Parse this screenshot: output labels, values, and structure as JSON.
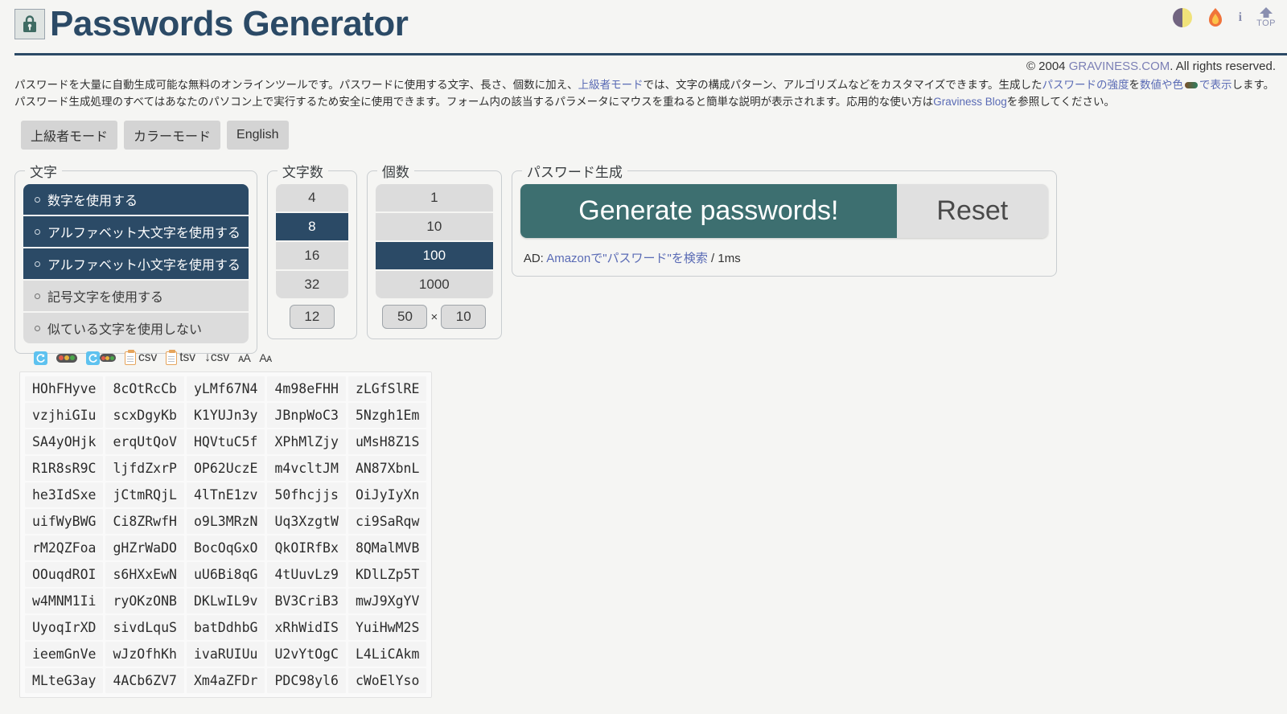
{
  "header": {
    "title": "Passwords Generator",
    "lock_icon": "lock-icon",
    "icons": [
      {
        "name": "theme-toggle-icon",
        "label": ""
      },
      {
        "name": "flame-icon",
        "label": ""
      },
      {
        "name": "info-icon",
        "label": "i"
      },
      {
        "name": "back-to-top-icon",
        "label": "TOP"
      }
    ]
  },
  "copyright": {
    "prefix": "© 2004 ",
    "link": "GRAVINESS.COM",
    "suffix": ". All rights reserved."
  },
  "description": {
    "p1_a": "パスワードを大量に自動生成可能な無料のオンラインツールです。パスワードに使用する文字、長さ、個数に加え、",
    "link1": "上級者モード",
    "p1_b": "では、文字の構成パターン、アルゴリズムなどをカスタマイズできます。生成した",
    "link2": "パスワードの強度",
    "p1_c": "を",
    "link3": "数値や色",
    "p1_d": "で表示",
    "p1_e": "します。パスワード生成処理のすべてはあなたのパソコン上で実行するため安全に使用できます。フォーム内の該当するパラメータにマウスを重ねると簡単な説明が表示されます。応用的な使い方は",
    "link4": "Graviness Blog",
    "p1_f": "を参照してください。"
  },
  "modes": [
    {
      "label": "上級者モード",
      "name": "advanced-mode-button"
    },
    {
      "label": "カラーモード",
      "name": "color-mode-button"
    },
    {
      "label": "English",
      "name": "english-mode-button"
    }
  ],
  "panels": {
    "chars": {
      "legend": "文字",
      "options": [
        {
          "label": "数字を使用する",
          "selected": true
        },
        {
          "label": "アルファベット大文字を使用する",
          "selected": true
        },
        {
          "label": "アルファベット小文字を使用する",
          "selected": true
        },
        {
          "label": "記号文字を使用する",
          "selected": false
        },
        {
          "label": "似ている文字を使用しない",
          "selected": false
        }
      ]
    },
    "length": {
      "legend": "文字数",
      "options": [
        {
          "label": "4",
          "selected": false
        },
        {
          "label": "8",
          "selected": true
        },
        {
          "label": "16",
          "selected": false
        },
        {
          "label": "32",
          "selected": false
        }
      ],
      "custom_value": "12"
    },
    "count": {
      "legend": "個数",
      "options": [
        {
          "label": "1",
          "selected": false
        },
        {
          "label": "10",
          "selected": false
        },
        {
          "label": "100",
          "selected": true
        },
        {
          "label": "1000",
          "selected": false
        }
      ],
      "custom_rows": "50",
      "multiply_symbol": "×",
      "custom_cols": "10"
    },
    "generate": {
      "legend": "パスワード生成",
      "generate_label": "Generate passwords!",
      "reset_label": "Reset",
      "ad_prefix": "AD: ",
      "ad_link": "Amazonで\"パスワード\"を検索",
      "ad_suffix": " / 1ms"
    }
  },
  "toolbar": [
    {
      "name": "refresh-icon",
      "label": ""
    },
    {
      "name": "strength-meter-icon",
      "label": ""
    },
    {
      "name": "refresh-strength-icon",
      "label": ""
    },
    {
      "name": "copy-csv-icon",
      "label": "csv"
    },
    {
      "name": "copy-tsv-icon",
      "label": "tsv"
    },
    {
      "name": "download-csv-icon",
      "label": "↓csv"
    },
    {
      "name": "font-size-increase-icon",
      "label": "ᴀA"
    },
    {
      "name": "font-size-decrease-icon",
      "label": "Aᴀ"
    }
  ],
  "passwords": {
    "columns": 5,
    "rows": [
      [
        "HOhFHyve",
        "8cOtRcCb",
        "yLMf67N4",
        "4m98eFHH",
        "zLGfSlRE"
      ],
      [
        "vzjhiGIu",
        "scxDgyKb",
        "K1YUJn3y",
        "JBnpWoC3",
        "5Nzgh1Em"
      ],
      [
        "SA4yOHjk",
        "erqUtQoV",
        "HQVtuC5f",
        "XPhMlZjy",
        "uMsH8Z1S"
      ],
      [
        "R1R8sR9C",
        "ljfdZxrP",
        "OP62UczE",
        "m4vcltJM",
        "AN87XbnL"
      ],
      [
        "he3IdSxe",
        "jCtmRQjL",
        "4lTnE1zv",
        "50fhcjjs",
        "OiJyIyXn"
      ],
      [
        "uifWyBWG",
        "Ci8ZRwfH",
        "o9L3MRzN",
        "Uq3XzgtW",
        "ci9SaRqw"
      ],
      [
        "rM2QZFoa",
        "gHZrWaDO",
        "BocOqGxO",
        "QkOIRfBx",
        "8QMalMVB"
      ],
      [
        "OOuqdROI",
        "s6HXxEwN",
        "uU6Bi8qG",
        "4tUuvLz9",
        "KDlLZp5T"
      ],
      [
        "w4MNM1Ii",
        "ryOKzONB",
        "DKLwIL9v",
        "BV3CriB3",
        "mwJ9XgYV"
      ],
      [
        "UyoqIrXD",
        "sivdLquS",
        "batDdhbG",
        "xRhWidIS",
        "YuiHwM2S"
      ],
      [
        "ieemGnVe",
        "wJzOfhKh",
        "ivaRUIUu",
        "U2vYtOgC",
        "L4LiCAkm"
      ],
      [
        "MLteG3ay",
        "4ACb6ZV7",
        "Xm4aZFDr",
        "PDC98yl6",
        "cWoElYso"
      ]
    ]
  },
  "colors": {
    "accent": "#2b4a66",
    "generate_button": "#3d6f70",
    "page_bg": "#f5f5f3",
    "link": "#5a6bb5"
  }
}
